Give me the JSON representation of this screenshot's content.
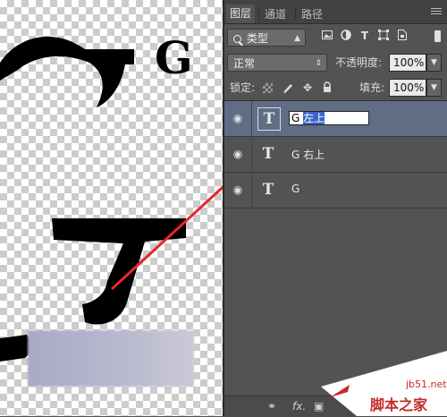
{
  "canvas": {
    "label_left_top": "G",
    "label_right_top": "G",
    "label_center": "J"
  },
  "tabs": [
    {
      "label": "图层",
      "active": true
    },
    {
      "label": "通道",
      "active": false
    },
    {
      "label": "路径",
      "active": false
    }
  ],
  "filter": {
    "kind_label": "类型",
    "icons": [
      "image-filter-icon",
      "adjustment-filter-icon",
      "type-filter-icon",
      "shape-filter-icon",
      "smart-object-filter-icon"
    ]
  },
  "blend": {
    "mode": "正常",
    "opacity_label": "不透明度:",
    "opacity_value": "100%"
  },
  "lock": {
    "label": "锁定:",
    "fill_label": "填充:",
    "fill_value": "100%"
  },
  "layers": [
    {
      "name_prefix": "G ",
      "name_selected": "左上",
      "selected": true,
      "editing": true,
      "thumb": "T"
    },
    {
      "name": "G 右上",
      "selected": false,
      "editing": false,
      "thumb": "T"
    },
    {
      "name": "G",
      "selected": false,
      "editing": false,
      "thumb": "T"
    }
  ],
  "bottom": {
    "fx_label": "fx."
  },
  "watermark": {
    "site": "jb51.net",
    "name": "脚本之家"
  },
  "colors": {
    "panel_bg": "#535353",
    "selected_layer": "#5f6d85",
    "arrow": "#e8262b",
    "watermark": "#c42b2b"
  }
}
